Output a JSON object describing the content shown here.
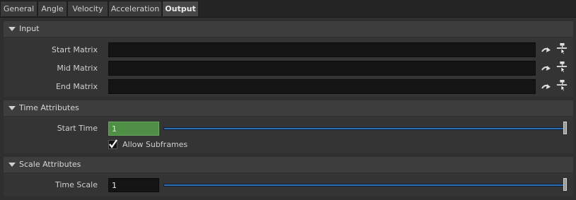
{
  "tabs": [
    {
      "label": "General"
    },
    {
      "label": "Angle"
    },
    {
      "label": "Velocity"
    },
    {
      "label": "Acceleration"
    },
    {
      "label": "Output",
      "active": true
    }
  ],
  "sections": {
    "input": {
      "title": "Input",
      "rows": [
        {
          "label": "Start Matrix",
          "value": ""
        },
        {
          "label": "Mid Matrix",
          "value": ""
        },
        {
          "label": "End Matrix",
          "value": ""
        }
      ],
      "row_icons": [
        "jump-arrow-icon",
        "node-picker-icon"
      ]
    },
    "time": {
      "title": "Time Attributes",
      "start_time": {
        "label": "Start Time",
        "value": "1",
        "slider_level": 1.0,
        "field_color": "#4e8f45"
      },
      "allow_subframes": {
        "label": "Allow Subframes",
        "checked": true
      }
    },
    "scale": {
      "title": "Scale Attributes",
      "time_scale": {
        "label": "Time Scale",
        "value": "1",
        "slider_level": 1.0
      }
    }
  },
  "colors": {
    "accent": "#2d6db0",
    "keyed_field": "#4e8f45",
    "background": "#2f2f2f"
  }
}
